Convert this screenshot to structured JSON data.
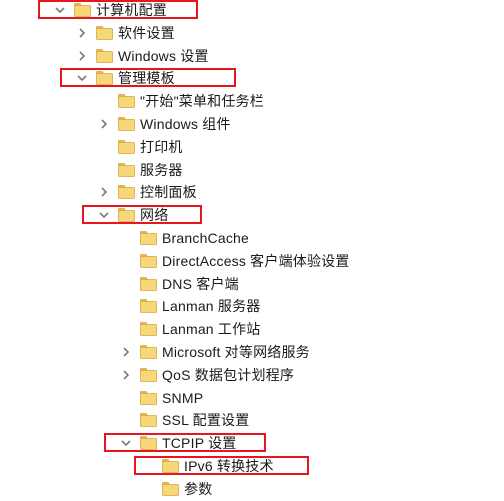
{
  "tree": {
    "items": [
      {
        "label": "计算机配置",
        "level": 0,
        "expander": "expanded",
        "highlight": true
      },
      {
        "label": "软件设置",
        "level": 1,
        "expander": "collapsed",
        "highlight": false
      },
      {
        "label": "Windows 设置",
        "level": 1,
        "expander": "collapsed",
        "highlight": false
      },
      {
        "label": "管理模板",
        "level": 1,
        "expander": "expanded",
        "highlight": true
      },
      {
        "label": "\"开始\"菜单和任务栏",
        "level": 2,
        "expander": "none",
        "highlight": false
      },
      {
        "label": "Windows 组件",
        "level": 2,
        "expander": "collapsed",
        "highlight": false
      },
      {
        "label": "打印机",
        "level": 2,
        "expander": "none",
        "highlight": false
      },
      {
        "label": "服务器",
        "level": 2,
        "expander": "none",
        "highlight": false
      },
      {
        "label": "控制面板",
        "level": 2,
        "expander": "collapsed",
        "highlight": false
      },
      {
        "label": "网络",
        "level": 2,
        "expander": "expanded",
        "highlight": true
      },
      {
        "label": "BranchCache",
        "level": 3,
        "expander": "none",
        "highlight": false
      },
      {
        "label": "DirectAccess 客户端体验设置",
        "level": 3,
        "expander": "none",
        "highlight": false
      },
      {
        "label": "DNS 客户端",
        "level": 3,
        "expander": "none",
        "highlight": false
      },
      {
        "label": "Lanman 服务器",
        "level": 3,
        "expander": "none",
        "highlight": false
      },
      {
        "label": "Lanman 工作站",
        "level": 3,
        "expander": "none",
        "highlight": false
      },
      {
        "label": "Microsoft 对等网络服务",
        "level": 3,
        "expander": "collapsed",
        "highlight": false
      },
      {
        "label": "QoS 数据包计划程序",
        "level": 3,
        "expander": "collapsed",
        "highlight": false
      },
      {
        "label": "SNMP",
        "level": 3,
        "expander": "none",
        "highlight": false
      },
      {
        "label": "SSL 配置设置",
        "level": 3,
        "expander": "none",
        "highlight": false
      },
      {
        "label": "TCPIP 设置",
        "level": 3,
        "expander": "expanded",
        "highlight": true
      },
      {
        "label": "IPv6 转换技术",
        "level": 4,
        "expander": "none",
        "highlight": true
      },
      {
        "label": "参数",
        "level": 4,
        "expander": "none",
        "highlight": false
      }
    ]
  },
  "colors": {
    "highlight_border": "#e8141e",
    "folder_fill": "#f6d77a",
    "folder_tab": "#e8b84a",
    "folder_edge": "#d9a73c",
    "chevron": "#7a7a7a",
    "text": "#1a1a1a"
  },
  "icons": {
    "folder": "folder-icon",
    "collapsed": "chevron-right-icon",
    "expanded": "chevron-down-icon"
  }
}
